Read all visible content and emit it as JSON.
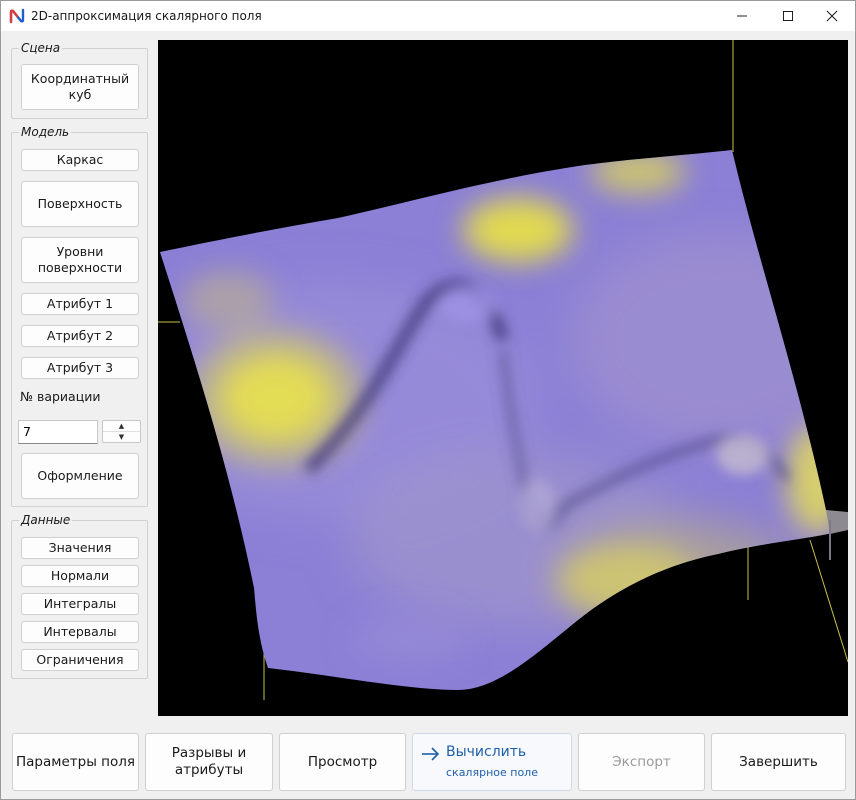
{
  "window": {
    "title": "2D-аппроксимация скалярного поля",
    "icon": "app-logo-icon"
  },
  "scene": {
    "label": "Сцена",
    "coord_cube": "Координатный куб"
  },
  "model": {
    "label": "Модель",
    "frame": "Каркас",
    "surface": "Поверхность",
    "levels": "Уровни поверхности",
    "attr1": "Атрибут 1",
    "attr2": "Атрибут 2",
    "attr3": "Атрибут 3",
    "variation_label": "№ вариации",
    "variation_value": "7",
    "design": "Оформление"
  },
  "data_group": {
    "label": "Данные",
    "values": "Значения",
    "normals": "Нормали",
    "integrals": "Интегралы",
    "intervals": "Интервалы",
    "limits": "Ограничения"
  },
  "bottom": {
    "field_params": "Параметры поля",
    "breaks": "Разрывы и атрибуты",
    "view": "Просмотр",
    "compute_main": "Вычислить",
    "compute_sub": "скалярное поле",
    "export": "Экспорт",
    "finish": "Завершить"
  },
  "colors": {
    "surface_base": "#8b7fd6",
    "highlight": "#e8e24a",
    "background": "#000000",
    "accent": "#1f5fa8"
  }
}
